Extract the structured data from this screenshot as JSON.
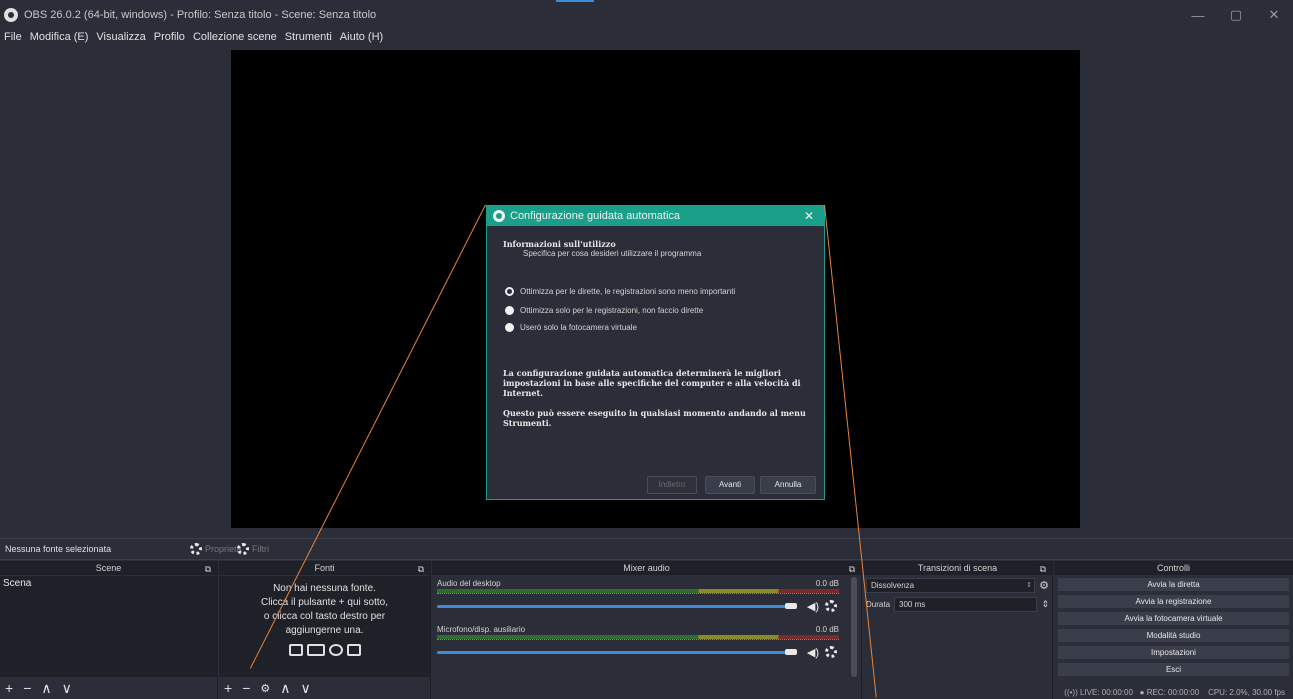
{
  "window": {
    "title": "OBS 26.0.2 (64-bit, windows) - Profilo: Senza titolo - Scene: Senza titolo",
    "minimize": "—",
    "maximize": "▢",
    "close": "✕"
  },
  "menu": [
    "File",
    "Modifica (E)",
    "Visualizza",
    "Profilo",
    "Collezione scene",
    "Strumenti",
    "Aiuto (H)"
  ],
  "toolbar": {
    "no_source": "Nessuna fonte selezionata",
    "properties": "Proprietà",
    "filters": "Filtri"
  },
  "docks": {
    "scenes": {
      "title": "Scene",
      "items": [
        "Scena"
      ]
    },
    "sources": {
      "title": "Fonti",
      "empty_text": [
        "Non hai nessuna fonte.",
        "Clicca il pulsante + qui sotto,",
        "o clicca col tasto destro per",
        "aggiungerne una."
      ]
    },
    "mixer": {
      "title": "Mixer audio",
      "channels": [
        {
          "name": "Audio del desktop",
          "db": "0.0 dB"
        },
        {
          "name": "Microfono/disp. ausiliario",
          "db": "0.0 dB"
        }
      ]
    },
    "transitions": {
      "title": "Transizioni di scena",
      "selected": "Dissolvenza",
      "duration_label": "Durata",
      "duration_value": "300 ms"
    },
    "controls": {
      "title": "Controlli",
      "buttons": [
        "Avvia la diretta",
        "Avvia la registrazione",
        "Avvia la fotocamera virtuale",
        "Modalità studio",
        "Impostazioni",
        "Esci"
      ]
    }
  },
  "status": {
    "live": "LIVE: 00:00:00",
    "rec": "REC: 00:00:00",
    "cpu": "CPU: 2.0%, 30.00 fps"
  },
  "dialog": {
    "title": "Configurazione guidata automatica",
    "heading": "Informazioni sull'utilizzo",
    "subheading": "Specifica per cosa desideri utilizzare il programma",
    "options": [
      {
        "label": "Ottimizza per le dirette, le registrazioni sono meno importanti",
        "selected": true
      },
      {
        "label": "Ottimizza solo per le registrazioni, non faccio dirette",
        "selected": false
      },
      {
        "label": "Userò solo la fotocamera virtuale",
        "selected": false
      }
    ],
    "description1": "La configurazione guidata automatica determinerà le migliori impostazioni in base alle specifiche del computer e alla velocità di Internet.",
    "description2": "Questo può essere eseguito in qualsiasi momento andando al menu Strumenti.",
    "back": "Indietro",
    "next": "Avanti",
    "cancel": "Annulla"
  }
}
